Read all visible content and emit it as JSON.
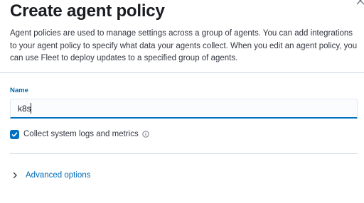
{
  "flyout": {
    "title": "Create agent policy",
    "description": "Agent policies are used to manage settings across a group of agents. You can add integrations to your agent policy to specify what data your agents collect. When you edit an agent policy, you can use Fleet to deploy updates to a specified group of agents.",
    "close_icon": "close-icon"
  },
  "form": {
    "name_label": "Name",
    "name_value": "k8s",
    "collect_checked": true,
    "collect_label": "Collect system logs and metrics",
    "info_icon": "info-icon",
    "advanced_label": "Advanced options",
    "advanced_icon": "chevron-right-icon"
  },
  "colors": {
    "accent": "#0071c2",
    "link": "#006bb8",
    "title": "#1a1c21",
    "text": "#343741",
    "border": "#d3dae6"
  }
}
